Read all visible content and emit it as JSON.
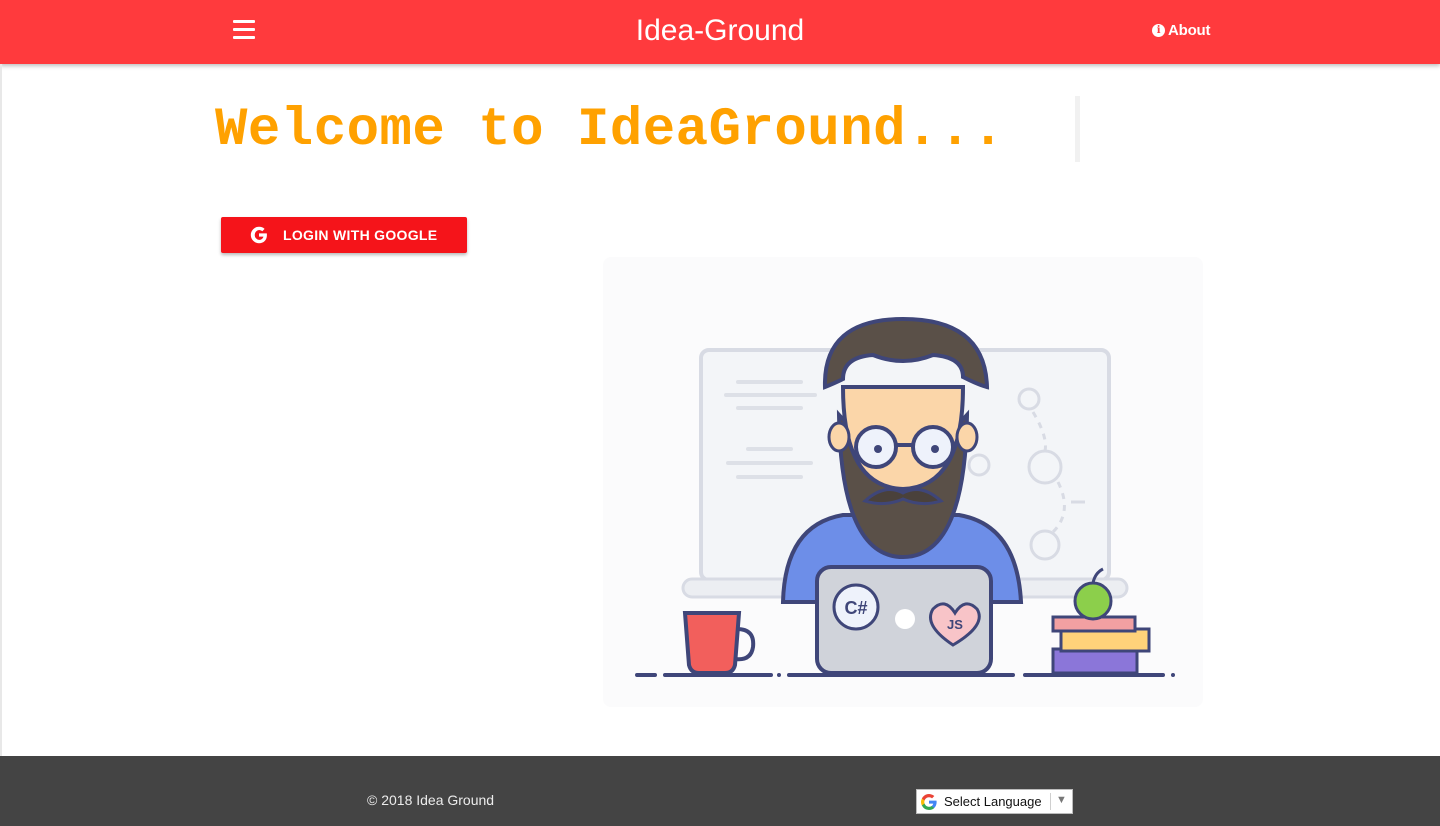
{
  "header": {
    "menu_icon": "hamburger-menu-icon",
    "title": "Idea-Ground",
    "about_label": "About",
    "about_icon": "info-circle-icon",
    "bg_color": "#ff3a3d"
  },
  "main": {
    "welcome_text": "Welcome to IdeaGround...",
    "welcome_color": "#ffa100",
    "login_button_label": "LOGIN WITH GOOGLE",
    "login_button_icon": "google-g-icon",
    "login_button_color": "#f5141a",
    "illustration": {
      "laptop_sticker_csharp": "C#",
      "laptop_sticker_js": "JS"
    }
  },
  "footer": {
    "copyright": "© 2018 Idea Ground",
    "language_select": {
      "selected": "Select Language",
      "icon": "google-g-icon"
    },
    "bg_color": "#444444"
  }
}
